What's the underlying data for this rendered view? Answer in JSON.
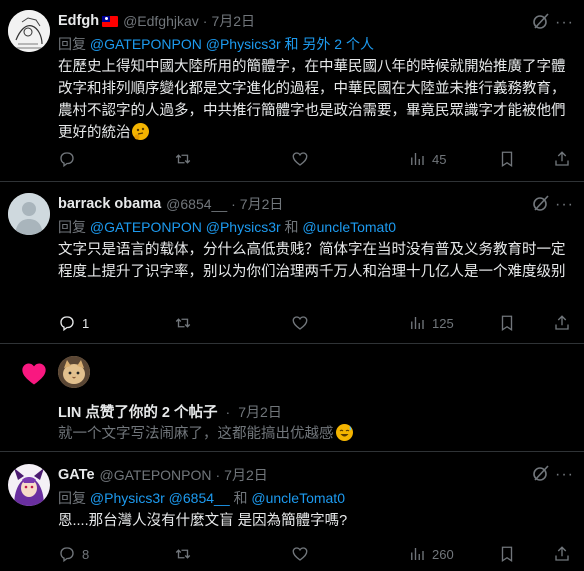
{
  "tweets": [
    {
      "name": "Edfgh",
      "handle": "@Edfghjkav",
      "time": "7月2日",
      "reply_prefix": "回复",
      "reply_mentions": "@GATEPONPON @Physics3r",
      "reply_suffix": "和 另外 2 个人",
      "body": "在歷史上得知中國大陸所用的簡體字，在中華民國八年的時候就開始推廣了字體改字和排列順序變化都是文字進化的過程，中華民國在大陸並未推行義務教育，農村不認字的人過多，中共推行簡體字也是政治需要，畢竟民眾識字才能被他們更好的統治",
      "views": "45"
    },
    {
      "name": "barrack obama",
      "handle": "@6854__",
      "time": "7月2日",
      "reply_prefix": "回复",
      "reply_mentions": "@GATEPONPON @Physics3r",
      "reply_and": "和",
      "reply_mention2": "@uncleTomat0",
      "body": "文字只是语言的载体，分什么高低贵贱？简体字在当时没有普及义务教育时一定程度上提升了识字率，别以为你们治理两千万人和治理十几亿人是一个难度级别",
      "replies": "1",
      "views": "125"
    },
    {
      "name": "GATe",
      "handle": "@GATEPONPON",
      "time": "7月2日",
      "reply_prefix": "回复",
      "reply_mentions": "@Physics3r @6854__",
      "reply_and": "和",
      "reply_mention2": "@uncleTomat0",
      "body": "恩....那台灣人沒有什麼文盲 是因為簡體字嗎?",
      "replies": "8",
      "views": "260"
    }
  ],
  "notification": {
    "name": "LIN",
    "action": "点赞了你的 2 个帖子",
    "time": "7月2日",
    "preview": "就一个文字写法闹麻了，这都能搞出优越感"
  },
  "colors": {
    "background": "#000000",
    "text": "#e7e9ea",
    "muted": "#71767b",
    "link": "#1d9bf0",
    "heart": "#f91880",
    "divider": "#2f3336"
  }
}
